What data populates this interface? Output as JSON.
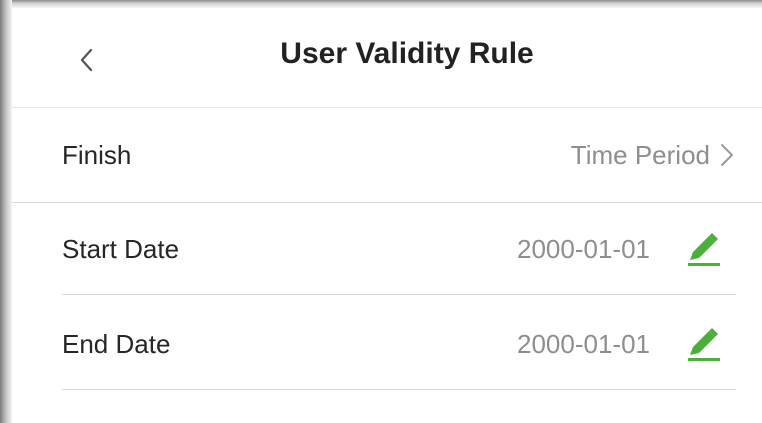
{
  "header": {
    "title": "User Validity Rule",
    "back_icon": "chevron-left-icon"
  },
  "rows": {
    "finish": {
      "label": "Finish",
      "value": "Time Period",
      "icon": "chevron-right-icon"
    },
    "start_date": {
      "label": "Start Date",
      "value": "2000-01-01",
      "icon": "pencil-icon"
    },
    "end_date": {
      "label": "End Date",
      "value": "2000-01-01",
      "icon": "pencil-icon"
    }
  },
  "colors": {
    "accent": "#4caf3c",
    "title": "#222222",
    "label": "#262626",
    "value": "#8e8e8e",
    "divider": "#d9d9d9"
  }
}
